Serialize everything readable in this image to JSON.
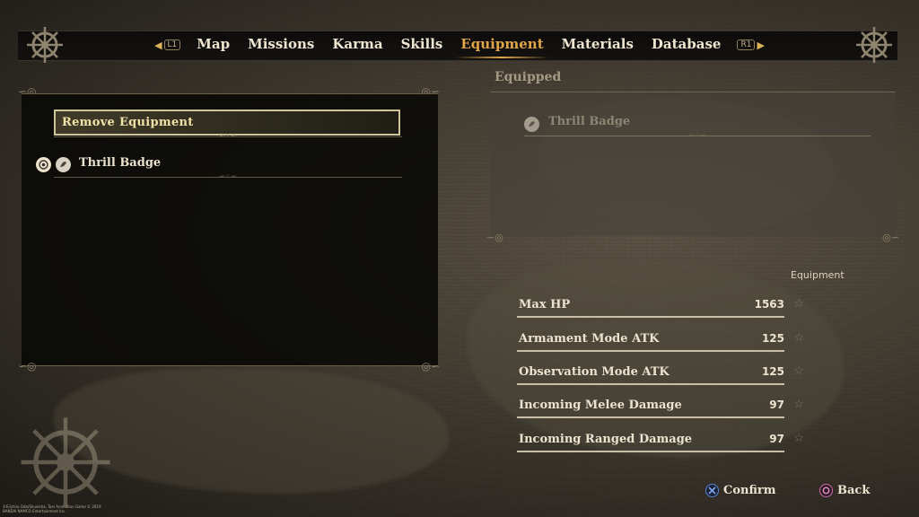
{
  "nav": {
    "left_key": "L1",
    "right_key": "R1",
    "tabs": [
      {
        "label": "Map"
      },
      {
        "label": "Missions"
      },
      {
        "label": "Karma"
      },
      {
        "label": "Skills"
      },
      {
        "label": "Equipment"
      },
      {
        "label": "Materials"
      },
      {
        "label": "Database"
      }
    ],
    "active_tab": "Equipment"
  },
  "left": {
    "remove_label": "Remove Equipment",
    "items": [
      {
        "name": "Thrill Badge",
        "icon": "badge-icon"
      }
    ]
  },
  "right": {
    "section_title": "Equipped",
    "equipped_item": {
      "name": "Thrill Badge",
      "icon": "badge-icon"
    },
    "column_header": "Equipment",
    "stats": [
      {
        "label": "Max HP",
        "value": "1563"
      },
      {
        "label": "Armament Mode ATK",
        "value": "125"
      },
      {
        "label": "Observation Mode ATK",
        "value": "125"
      },
      {
        "label": "Incoming Melee Damage",
        "value": "97"
      },
      {
        "label": "Incoming Ranged Damage",
        "value": "97"
      }
    ]
  },
  "footer": {
    "confirm_label": "Confirm",
    "back_label": "Back",
    "copyright": "©Eiichiro Oda/Shueisha, Toei Animation Game © 2019 BANDAI NAMCO Entertainment Inc."
  },
  "colors": {
    "accent": "#e0a54a",
    "confirm_icon": "#5a86d6",
    "back_icon": "#d36aa8"
  }
}
